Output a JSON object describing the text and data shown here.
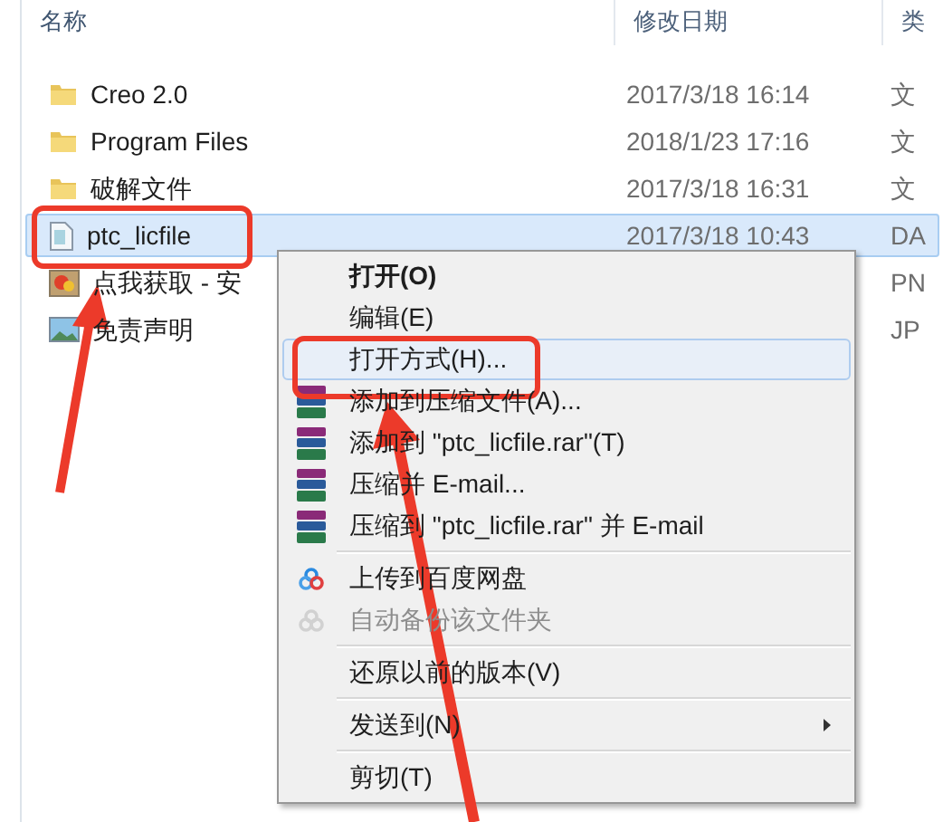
{
  "columns": [
    {
      "label": "名称",
      "sorted": true
    },
    {
      "label": "修改日期",
      "sorted": false
    },
    {
      "label": "类",
      "sorted": false
    }
  ],
  "rows": [
    {
      "kind": "folder",
      "name": "Creo 2.0",
      "date": "2017/3/18 16:14",
      "type": "文",
      "selected": false
    },
    {
      "kind": "folder",
      "name": "Program Files",
      "date": "2018/1/23 17:16",
      "type": "文",
      "selected": false
    },
    {
      "kind": "folder",
      "name": "破解文件",
      "date": "2017/3/18 16:31",
      "type": "文",
      "selected": false
    },
    {
      "kind": "file",
      "name": "ptc_licfile",
      "date": "2017/3/18 10:43",
      "type": "DA",
      "selected": true
    },
    {
      "kind": "png",
      "name": "点我获取 - 安",
      "type": "PN",
      "selected": false
    },
    {
      "kind": "jpg",
      "name": "免责声明",
      "type": "JP",
      "selected": false
    }
  ],
  "context_menu": [
    {
      "kind": "item",
      "label": "打开(O)",
      "default": true
    },
    {
      "kind": "item",
      "label": "编辑(E)"
    },
    {
      "kind": "item",
      "label": "打开方式(H)...",
      "selected": true
    },
    {
      "kind": "archive",
      "label": "添加到压缩文件(A)..."
    },
    {
      "kind": "archive",
      "label": "添加到 \"ptc_licfile.rar\"(T)"
    },
    {
      "kind": "archive",
      "label": "压缩并 E-mail..."
    },
    {
      "kind": "archive",
      "label": "压缩到 \"ptc_licfile.rar\" 并 E-mail"
    },
    {
      "kind": "separator"
    },
    {
      "kind": "cloud",
      "label": "上传到百度网盘"
    },
    {
      "kind": "cloud",
      "label": "自动备份该文件夹",
      "disabled": true
    },
    {
      "kind": "separator"
    },
    {
      "kind": "item",
      "label": "还原以前的版本(V)"
    },
    {
      "kind": "separator"
    },
    {
      "kind": "item",
      "label": "发送到(N)",
      "submenu": true
    },
    {
      "kind": "separator"
    },
    {
      "kind": "item",
      "label": "剪切(T)"
    }
  ]
}
